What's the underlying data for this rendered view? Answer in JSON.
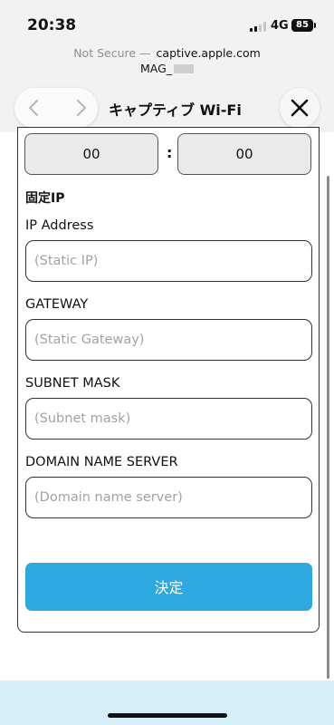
{
  "status_bar": {
    "time": "20:38",
    "network": "4G",
    "battery": "85"
  },
  "browser": {
    "security_label": "Not Secure —",
    "domain": "captive.apple.com",
    "ssid_prefix": "MAG_",
    "title": "キャプティブ Wi-Fi"
  },
  "form": {
    "time": {
      "hours": "00",
      "minutes": "00",
      "separator": ":"
    },
    "section_title": "固定IP",
    "fields": [
      {
        "label": "IP Address",
        "placeholder": "(Static IP)"
      },
      {
        "label": "GATEWAY",
        "placeholder": "(Static Gateway)"
      },
      {
        "label": "SUBNET MASK",
        "placeholder": "(Subnet mask)"
      },
      {
        "label": "DOMAIN NAME SERVER",
        "placeholder": "(Domain name server)"
      }
    ],
    "submit_label": "決定"
  },
  "colors": {
    "accent": "#2ea8e0",
    "bottom_bg": "#d6eef7"
  }
}
